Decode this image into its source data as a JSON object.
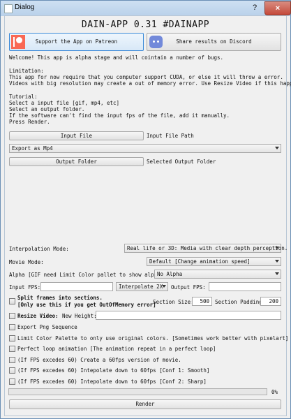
{
  "window": {
    "title": "Dialog",
    "help": "?",
    "close": "×"
  },
  "app_title": "DAIN-APP 0.31 #DAINAPP",
  "patreon_button": "Support the App on Patreon",
  "discord_button": "Share results on Discord",
  "info_lines": [
    "Welcome! This app is alpha stage and will cointain a number of bugs.",
    "",
    "Limitation:",
    "This app for now require that you computer support CUDA, or else it will throw a error.",
    "Videos with big resolution may create a out of memory error. Use Resize Video if this happen.",
    "",
    "Tutorial:",
    "Select a input file [gif, mp4, etc]",
    "Select an output folder.",
    "If the software can't find the input fps of the file, add it manually.",
    "Press Render."
  ],
  "input_file_button": "Input File",
  "input_file_path": "Input File Path",
  "export_combo": "Export as Mp4",
  "output_folder_button": "Output Folder",
  "output_folder_path": "Selected Output Folder",
  "interpolation_mode": {
    "label": "Interpolation Mode:",
    "value": "Real life or 3D: Media with clear depth perception."
  },
  "movie_mode": {
    "label": "Movie Mode:",
    "value": "Default [Change animation speed]"
  },
  "alpha": {
    "label": "Alpha [GIF need Limit Color pallet to show alpha]:",
    "value": "No Alpha"
  },
  "input_fps": {
    "label": "Input FPS:",
    "value": ""
  },
  "interpolate": {
    "value": "Interpolate 2X"
  },
  "output_fps": {
    "label": "Output FPS:",
    "value": ""
  },
  "split_frames": {
    "label_line1": "Split frames into sections.",
    "label_line2": "[Only use this if you get OutOfMemory error]",
    "checked": false
  },
  "section_size": {
    "label": "Section Size:",
    "value": "500"
  },
  "section_padding": {
    "label": "Section Padding:",
    "value": "200"
  },
  "resize_video": {
    "label": "Resize Video:",
    "checked": false
  },
  "new_height": {
    "label": "New Height:",
    "value": ""
  },
  "options": [
    {
      "label": "Export Png Sequence",
      "checked": false
    },
    {
      "label": "Limit Color Palette to only use original colors. [Sometimes work better with pixelart]",
      "checked": false
    },
    {
      "label": "Perfect loop animation [The animation repeat in a perfect loop]",
      "checked": false
    },
    {
      "label": "(If FPS excedes 60) Create a 60fps version of movie.",
      "checked": false
    },
    {
      "label": "(If FPS excedes 60) Intepolate down to 60fps [Conf 1: Smooth]",
      "checked": false
    },
    {
      "label": "(If FPS excedes 60) Intepolate down to 60fps [Conf 2: Sharp]",
      "checked": false
    }
  ],
  "progress": {
    "value": 0,
    "label": "0%"
  },
  "render_button": "Render"
}
